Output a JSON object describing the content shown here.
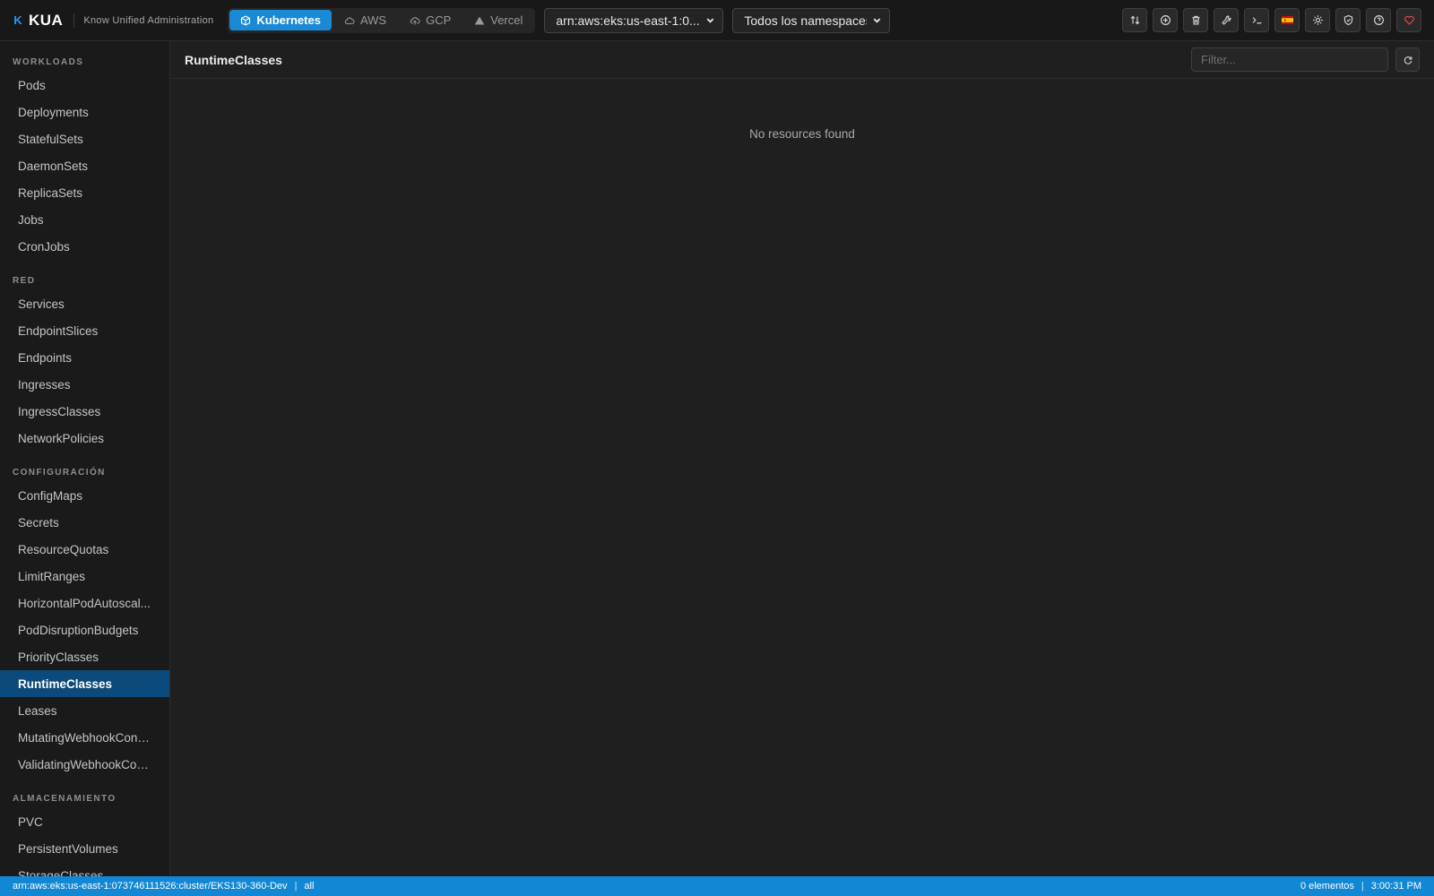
{
  "app": {
    "brand": "KUA",
    "logo_mark": "K",
    "subtitle": "Know Unified Administration",
    "accent_color": "#1a8ad6"
  },
  "provider_tabs": [
    {
      "label": "Kubernetes",
      "icon": "cube-icon",
      "active": true
    },
    {
      "label": "AWS",
      "icon": "cloud-icon",
      "active": false
    },
    {
      "label": "GCP",
      "icon": "cloud-upload-icon",
      "active": false
    },
    {
      "label": "Vercel",
      "icon": "triangle-icon",
      "active": false
    }
  ],
  "cluster_select": {
    "value": "arn:aws:eks:us-east-1:0..."
  },
  "namespace_select": {
    "value": "Todos los namespaces"
  },
  "toolbar": {
    "buttons": [
      {
        "name": "port-forward",
        "icon": "arrows-swap-icon"
      },
      {
        "name": "create-resource",
        "icon": "plus-circle-icon"
      },
      {
        "name": "delete",
        "icon": "trash-icon"
      },
      {
        "name": "tools",
        "icon": "wrench-icon"
      },
      {
        "name": "terminal",
        "icon": "terminal-icon"
      },
      {
        "name": "language",
        "icon": "spain-flag-icon"
      },
      {
        "name": "theme",
        "icon": "sun-icon"
      },
      {
        "name": "security",
        "icon": "shield-icon"
      },
      {
        "name": "help",
        "icon": "help-circle-icon"
      },
      {
        "name": "favorites",
        "icon": "heart-icon"
      }
    ]
  },
  "sidebar": {
    "sections": [
      {
        "title": "WORKLOADS",
        "items": [
          "Pods",
          "Deployments",
          "StatefulSets",
          "DaemonSets",
          "ReplicaSets",
          "Jobs",
          "CronJobs"
        ]
      },
      {
        "title": "RED",
        "items": [
          "Services",
          "EndpointSlices",
          "Endpoints",
          "Ingresses",
          "IngressClasses",
          "NetworkPolicies"
        ]
      },
      {
        "title": "CONFIGURACIÓN",
        "items": [
          "ConfigMaps",
          "Secrets",
          "ResourceQuotas",
          "LimitRanges",
          "HorizontalPodAutoscal...",
          "PodDisruptionBudgets",
          "PriorityClasses",
          "RuntimeClasses",
          "Leases",
          "MutatingWebhookConfi...",
          "ValidatingWebhookCon..."
        ]
      },
      {
        "title": "ALMACENAMIENTO",
        "items": [
          "PVC",
          "PersistentVolumes",
          "StorageClasses"
        ]
      }
    ],
    "active_item": "RuntimeClasses"
  },
  "main": {
    "title": "RuntimeClasses",
    "filter_placeholder": "Filter...",
    "filter_value": "",
    "empty_message": "No resources found"
  },
  "status_bar": {
    "cluster": "arn:aws:eks:us-east-1:073746111526:cluster/EKS130-360-Dev",
    "separator": "|",
    "namespace": "all",
    "count": "0 elementos",
    "time": "3:00:31 PM"
  }
}
